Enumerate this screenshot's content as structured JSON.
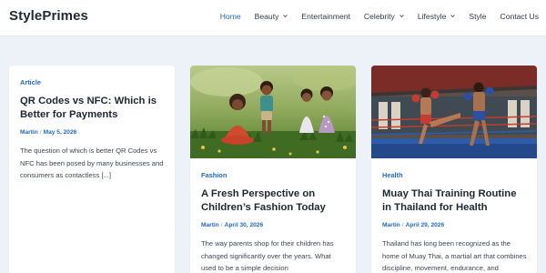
{
  "site": {
    "title": "StylePrimes"
  },
  "nav": {
    "items": [
      {
        "label": "Home",
        "active": true,
        "dropdown": false
      },
      {
        "label": "Beauty",
        "active": false,
        "dropdown": true
      },
      {
        "label": "Entertainment",
        "active": false,
        "dropdown": false
      },
      {
        "label": "Celebrity",
        "active": false,
        "dropdown": true
      },
      {
        "label": "Lifestyle",
        "active": false,
        "dropdown": true
      },
      {
        "label": "Style",
        "active": false,
        "dropdown": false
      },
      {
        "label": "Contact Us",
        "active": false,
        "dropdown": false
      }
    ]
  },
  "colors": {
    "accent": "#2169c9",
    "background": "#edf2f8",
    "card": "#ffffff",
    "text": "#1d2733"
  },
  "posts": [
    {
      "category": "Article",
      "title": "QR Codes vs NFC: Which is Better for Payments",
      "author": "Martin",
      "date": "May 5, 2026",
      "excerpt": "The question of which is better QR Codes vs NFC has been posed by many businesses and consumers as contactless [...]"
    },
    {
      "category": "Fashion",
      "title": "A Fresh Perspective on Children’s Fashion Today",
      "author": "Martin",
      "date": "April 30, 2026",
      "excerpt": "The way parents shop for their children has changed significantly over the years. What used to be a simple decision",
      "image": "children-playing-outdoors-photo"
    },
    {
      "category": "Health",
      "title": "Muay Thai Training Routine in Thailand for Health",
      "author": "Martin",
      "date": "April 29, 2026",
      "excerpt": "Thailand has long been recognized as the home of Muay Thai, a martial art that combines discipline, movement, endurance, and",
      "image": "muay-thai-sparring-photo"
    }
  ]
}
